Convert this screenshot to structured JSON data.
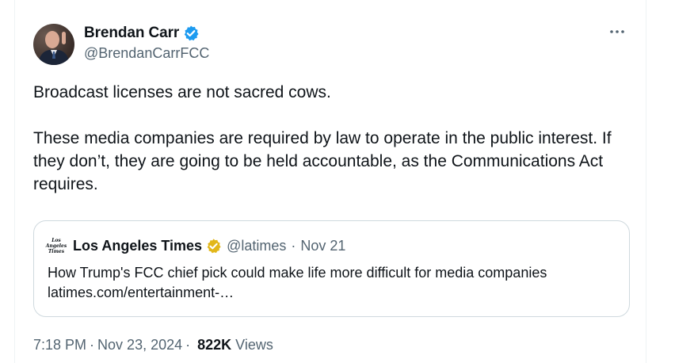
{
  "post": {
    "author_name": "Brendan Carr",
    "author_handle": "@BrendanCarrFCC",
    "paragraphs": [
      "Broadcast licenses are not sacred cows.",
      "These media companies are required by law to operate in the public interest. If they don’t, they are going to be held accountable, as the Communications Act requires."
    ],
    "time": "7:18 PM",
    "date": "Nov 23, 2024",
    "views_count": "822K",
    "views_label": "Views",
    "separator": "·"
  },
  "quoted_post": {
    "logo_lines": [
      "Los",
      "Angeles",
      "Times"
    ],
    "author_name": "Los Angeles Times",
    "author_handle": "@latimes",
    "separator": "·",
    "date": "Nov 21",
    "text": "How Trump's FCC chief pick could make life more difficult for media companies latimes.com/entertainment-…"
  },
  "icons": {
    "verified": "verified-badge-icon",
    "gold_verified": "gold-verified-badge-icon",
    "more": "more-options-icon"
  },
  "colors": {
    "verified_blue": "#1d9bf0",
    "verified_gold": "#e2b719",
    "text_primary": "#0f1419",
    "text_secondary": "#536471",
    "border": "#cfd9de"
  }
}
